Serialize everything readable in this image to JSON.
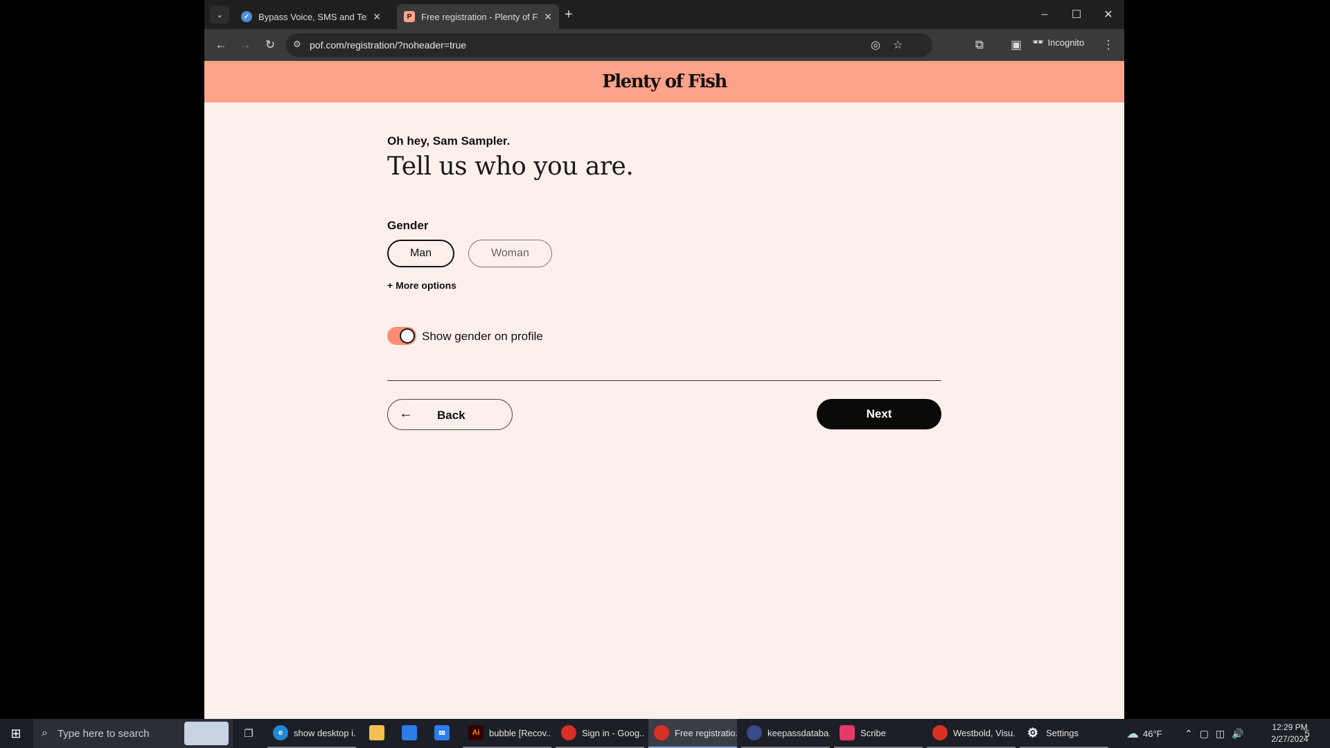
{
  "browser": {
    "tabs": [
      {
        "title": "Bypass Voice, SMS and Text Ver",
        "favicon": "check-circle-icon",
        "active": false
      },
      {
        "title": "Free registration - Plenty of Fish",
        "favicon": "pof-logo-icon",
        "active": true
      }
    ],
    "url": "pof.com/registration/?noheader=true",
    "incognito_label": "Incognito"
  },
  "page": {
    "logo": "Plenty of Fish",
    "greeting": "Oh hey, Sam Sampler.",
    "headline": "Tell us who you are.",
    "gender_label": "Gender",
    "options": {
      "man": "Man",
      "woman": "Woman"
    },
    "selected_gender": "Man",
    "more_options": "+ More options",
    "toggle_label": "Show gender on profile",
    "toggle_on": true,
    "back_label": "Back",
    "next_label": "Next",
    "accent_color": "#ffa28a"
  },
  "taskbar": {
    "search_placeholder": "Type here to search",
    "items": [
      {
        "label": "show desktop i...",
        "icon": "edge-icon",
        "color": "#1e8ad6"
      },
      {
        "label": "",
        "icon": "file-explorer-icon",
        "color": "#f2c14e"
      },
      {
        "label": "",
        "icon": "store-icon",
        "color": "#2b7de9"
      },
      {
        "label": "",
        "icon": "mail-icon",
        "color": "#2b7de9"
      },
      {
        "label": "bubble [Recov...",
        "icon": "illustrator-icon",
        "color": "#d9431f"
      },
      {
        "label": "Sign in - Goog...",
        "icon": "chrome-icon",
        "color": "#d93025"
      },
      {
        "label": "Free registratio...",
        "icon": "chrome-icon",
        "color": "#d93025"
      },
      {
        "label": "keepassdataba...",
        "icon": "keepass-icon",
        "color": "#3a4a8a"
      },
      {
        "label": "Scribe",
        "icon": "scribe-icon",
        "color": "#e6396a"
      },
      {
        "label": "Westbold, Visu...",
        "icon": "chrome-icon",
        "color": "#d93025"
      },
      {
        "label": "Settings",
        "icon": "gear-icon",
        "color": "#555"
      }
    ],
    "weather": "46°F",
    "time": "12:29 PM",
    "date": "2/27/2024",
    "notification_count": "5"
  }
}
